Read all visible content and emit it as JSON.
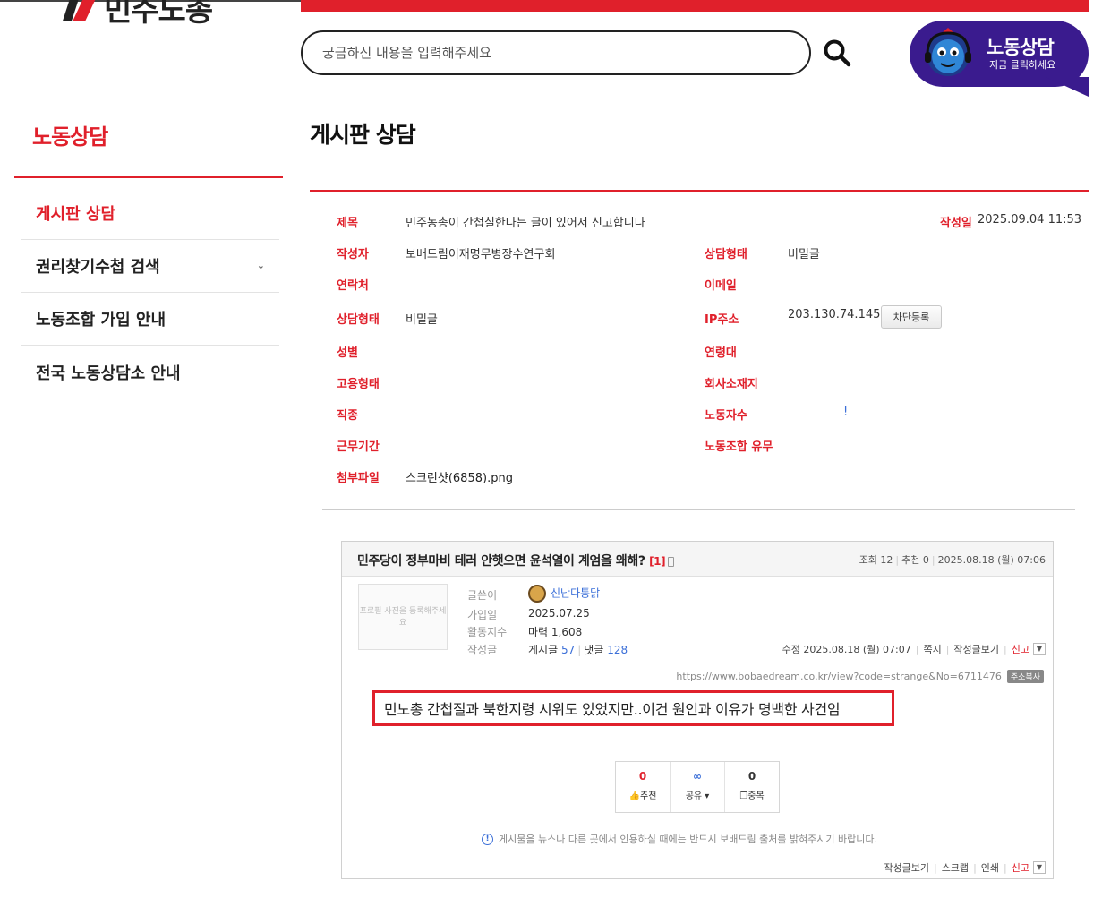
{
  "header": {
    "logo_text": "민주노총",
    "search_placeholder": "궁금하신 내용을 입력해주세요",
    "consult_banner": {
      "title": "노동상담",
      "subtitle": "지금 클릭하세요"
    }
  },
  "sidebar": {
    "title": "노동상담",
    "items": [
      {
        "label": "게시판 상담"
      },
      {
        "label": "권리찾기수첩 검색"
      },
      {
        "label": "노동조합 가입 안내"
      },
      {
        "label": "전국 노동상담소 안내"
      }
    ]
  },
  "page": {
    "title": "게시판 상담",
    "fields": {
      "subject_label": "제목",
      "subject_value": "민주농총이 간첩칠한다는 글이 있어서 신고합니다",
      "date_label": "작성일",
      "date_value": "2025.09.04 11:53",
      "author_label": "작성자",
      "author_value": "보배드림이재명무병장수연구회",
      "type_label": "상담형태",
      "type_value": "비밀글",
      "contact_label": "연락처",
      "email_label": "이메일",
      "type2_label": "상담형태",
      "type2_value": "비밀글",
      "ip_label": "IP주소",
      "ip_value": "203.130.74.145",
      "block_button": "차단등록",
      "gender_label": "성별",
      "age_label": "연령대",
      "employment_label": "고용형태",
      "company_label": "회사소재지",
      "job_label": "직종",
      "workers_label": "노동자수",
      "workers_value": "!",
      "period_label": "근무기간",
      "union_label": "노동조합 유무",
      "attach_label": "첨부파일",
      "attach_value": "스크린샷(6858).png"
    }
  },
  "screenshot": {
    "title": "민주당이 정부마비 테러 안햇으면 윤석열이 계엄을 왜해?",
    "comment_count": "[1]",
    "stats": {
      "views_label": "조회",
      "views": "12",
      "recommend_label": "추천",
      "recommend": "0",
      "date": "2025.08.18 (월) 07:06"
    },
    "profile_placeholder": "프로필 사진을 등록해주세요",
    "meta": {
      "writer_label": "글쓴이",
      "writer": "신난다통닭",
      "joined_label": "가입일",
      "joined": "2025.07.25",
      "activity_label": "활동지수",
      "activity": "마력 1,608",
      "posts_label": "작성글",
      "posts_text": "게시글",
      "posts_count": "57",
      "comments_text": "댓글",
      "comments_count": "128"
    },
    "edit_row": {
      "modified": "수정 2025.08.18 (월) 07:07",
      "message": "쪽지",
      "view_posts": "작성글보기",
      "report": "신고"
    },
    "url": "https://www.bobaedream.co.kr/view?code=strange&No=6711476",
    "copy_label": "주소복사",
    "quote": "민노총 간첩질과 북한지령 시위도 있었지만..이건 원인과 이유가 명백한 사건임",
    "votes": {
      "recommend_count": "0",
      "recommend_label": "추천",
      "share_label": "공유",
      "dup_count": "0",
      "dup_label": "중복"
    },
    "notice": "게시물을 뉴스나 다른 곳에서 인용하실 때에는 반드시 보배드림 출처를 밝혀주시기 바랍니다.",
    "bottom": {
      "view_posts": "작성글보기",
      "scrap": "스크랩",
      "print": "인쇄",
      "report": "신고"
    }
  },
  "colors": {
    "accent": "#e0202b",
    "banner": "#3a1b8e",
    "link_blue": "#3b6fd8"
  }
}
